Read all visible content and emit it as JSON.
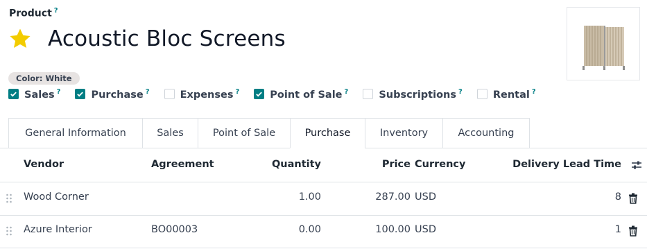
{
  "header": {
    "label": "Product",
    "help": "?",
    "title": "Acoustic Bloc Screens",
    "favorite": true,
    "variant_chip": "Color: White"
  },
  "options": [
    {
      "label": "Sales",
      "checked": true,
      "help": "?"
    },
    {
      "label": "Purchase",
      "checked": true,
      "help": "?"
    },
    {
      "label": "Expenses",
      "checked": false,
      "help": "?"
    },
    {
      "label": "Point of Sale",
      "checked": true,
      "help": "?"
    },
    {
      "label": "Subscriptions",
      "checked": false,
      "help": "?"
    },
    {
      "label": "Rental",
      "checked": false,
      "help": "?"
    }
  ],
  "tabs": [
    {
      "label": "General Information",
      "active": false
    },
    {
      "label": "Sales",
      "active": false
    },
    {
      "label": "Point of Sale",
      "active": false
    },
    {
      "label": "Purchase",
      "active": true
    },
    {
      "label": "Inventory",
      "active": false
    },
    {
      "label": "Accounting",
      "active": false
    }
  ],
  "table": {
    "columns": {
      "vendor": "Vendor",
      "agreement": "Agreement",
      "quantity": "Quantity",
      "price": "Price",
      "currency": "Currency",
      "lead_time": "Delivery Lead Time"
    },
    "rows": [
      {
        "vendor": "Wood Corner",
        "agreement": "",
        "quantity": "1.00",
        "price": "287.00",
        "currency": "USD",
        "lead_time": "8"
      },
      {
        "vendor": "Azure Interior",
        "agreement": "BO00003",
        "quantity": "0.00",
        "price": "100.00",
        "currency": "USD",
        "lead_time": "1"
      }
    ]
  },
  "colors": {
    "accent": "#017e84",
    "star": "#f3cc00",
    "chip_bg": "#e7e3e2"
  },
  "icons": {
    "favorite": "star-icon",
    "column_config": "sliders-icon",
    "row_handle": "drag-handle-icon",
    "delete": "trash-icon"
  }
}
